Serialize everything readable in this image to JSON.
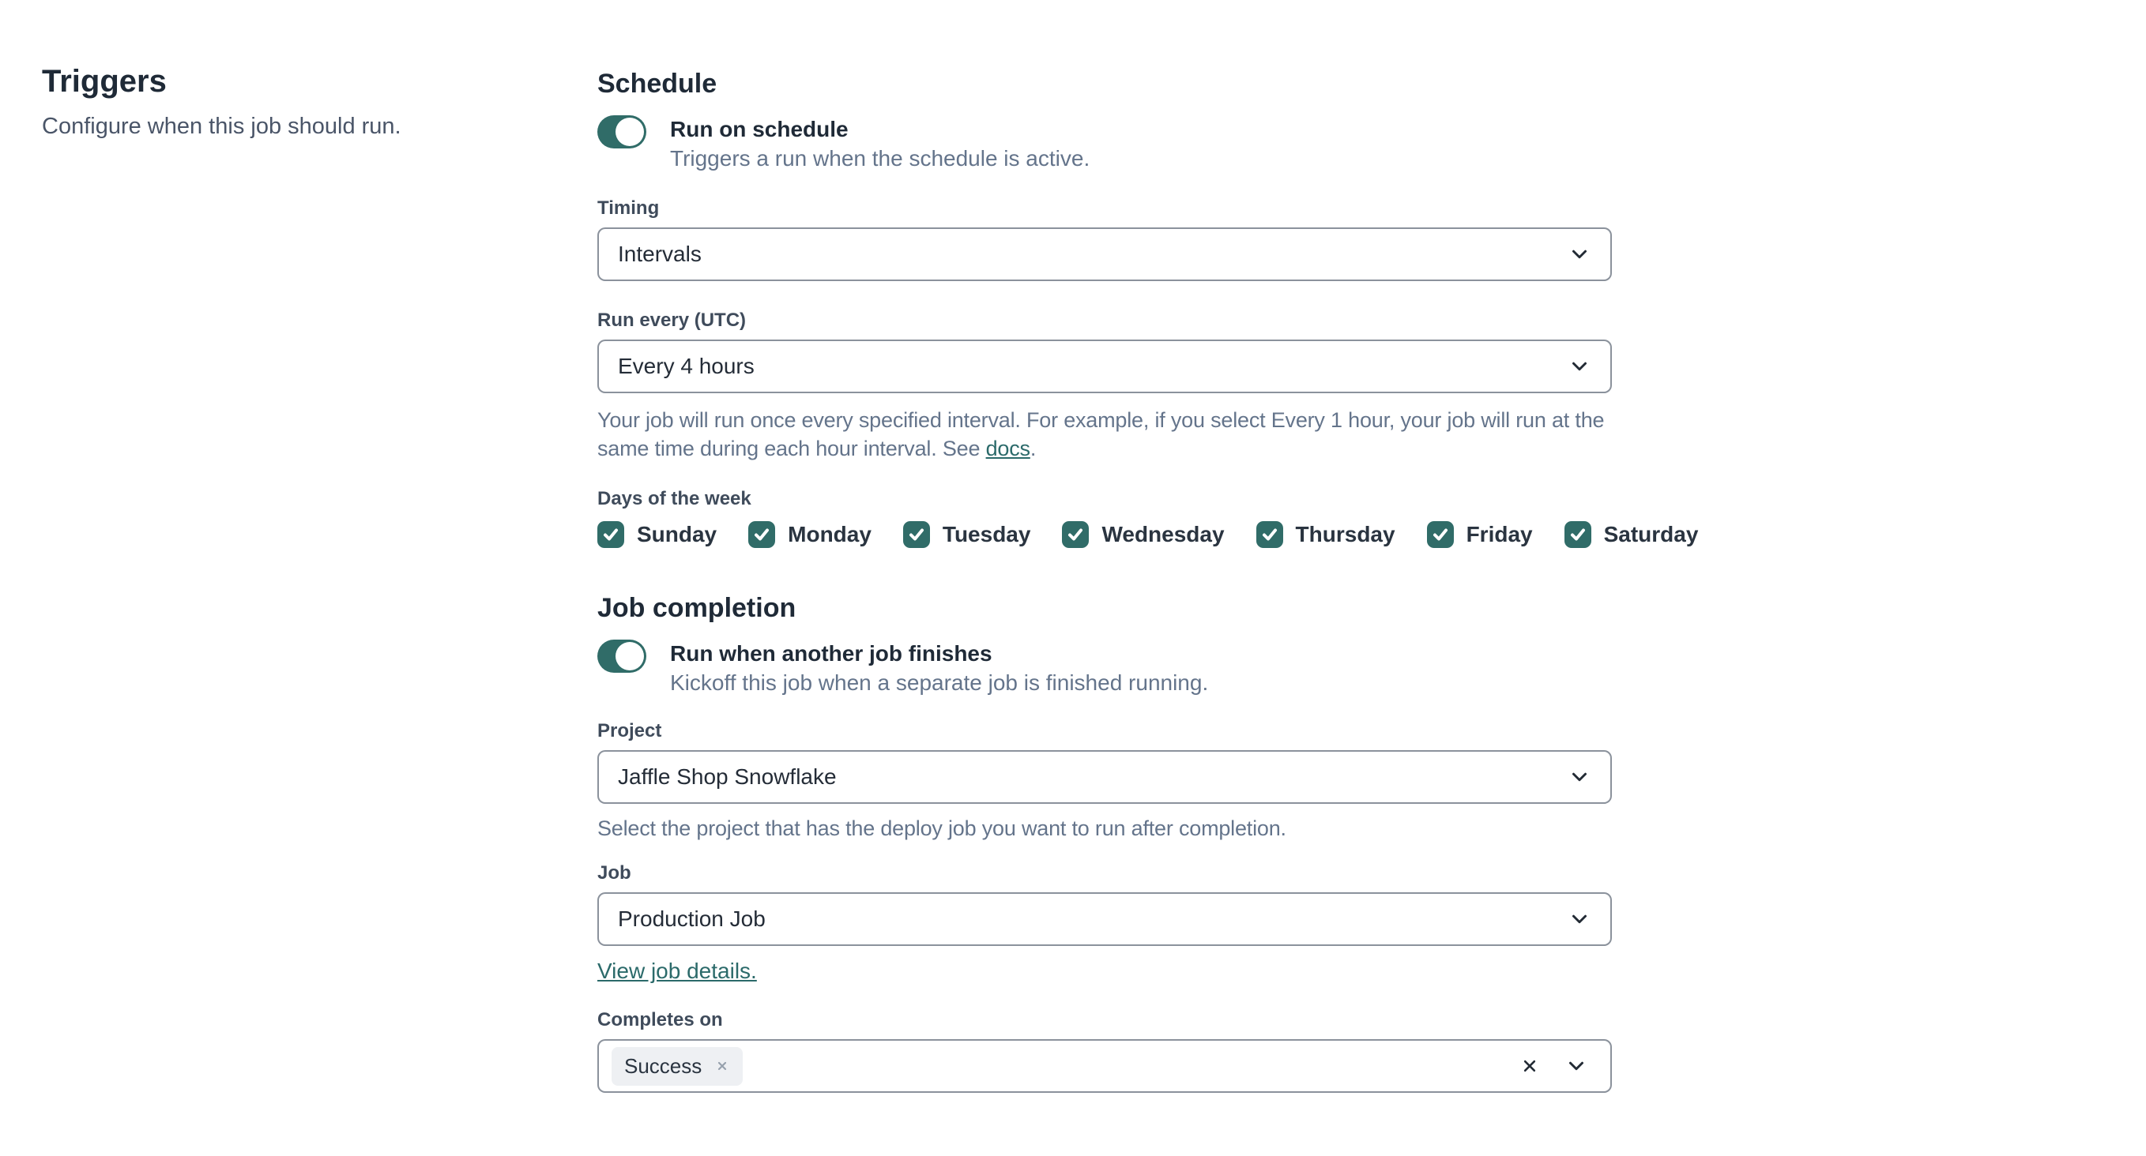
{
  "colors": {
    "teal": "#306C68",
    "link": "#2B6A6A"
  },
  "page": {
    "title": "Triggers",
    "subtitle": "Configure when this job should run."
  },
  "schedule": {
    "heading": "Schedule",
    "toggle": {
      "label": "Run on schedule",
      "description": "Triggers a run when the schedule is active.",
      "state": "on"
    },
    "timing": {
      "label": "Timing",
      "value": "Intervals"
    },
    "run_every": {
      "label": "Run every (UTC)",
      "value": "Every 4 hours",
      "help_before_link": "Your job will run once every specified interval. For example, if you select Every 1 hour, your job will run at the same time during each hour interval. See ",
      "help_link": "docs",
      "help_after_link": "."
    },
    "days": {
      "label": "Days of the week",
      "items": [
        {
          "label": "Sunday",
          "checked": true
        },
        {
          "label": "Monday",
          "checked": true
        },
        {
          "label": "Tuesday",
          "checked": true
        },
        {
          "label": "Wednesday",
          "checked": true
        },
        {
          "label": "Thursday",
          "checked": true
        },
        {
          "label": "Friday",
          "checked": true
        },
        {
          "label": "Saturday",
          "checked": true
        }
      ]
    }
  },
  "job_completion": {
    "heading": "Job completion",
    "toggle": {
      "label": "Run when another job finishes",
      "description": "Kickoff this job when a separate job is finished running.",
      "state": "on"
    },
    "project": {
      "label": "Project",
      "value": "Jaffle Shop Snowflake",
      "help": "Select the project that has the deploy job you want to run after completion."
    },
    "job": {
      "label": "Job",
      "value": "Production Job",
      "link": "View job details."
    },
    "completes_on": {
      "label": "Completes on",
      "tags": [
        {
          "label": "Success"
        }
      ]
    }
  }
}
